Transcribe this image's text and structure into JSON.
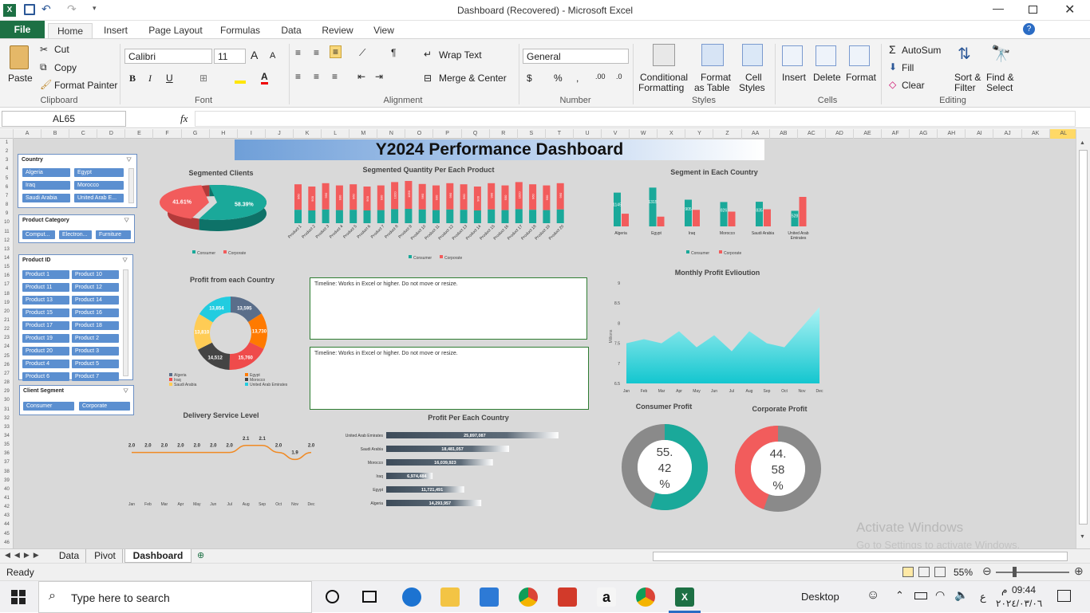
{
  "window": {
    "title": "Dashboard (Recovered)  -  Microsoft Excel"
  },
  "tabs": [
    "File",
    "Home",
    "Insert",
    "Page Layout",
    "Formulas",
    "Data",
    "Review",
    "View"
  ],
  "ribbon": {
    "clipboard": {
      "paste": "Paste",
      "cut": "Cut",
      "copy": "Copy",
      "format_painter": "Format Painter",
      "group": "Clipboard"
    },
    "font": {
      "name": "Calibri",
      "size": "11",
      "group": "Font"
    },
    "alignment": {
      "wrap": "Wrap Text",
      "merge": "Merge & Center",
      "group": "Alignment"
    },
    "number": {
      "format": "General",
      "group": "Number"
    },
    "styles": {
      "cond": "Conditional",
      "cond2": "Formatting",
      "fmt_table": "Format",
      "fmt_table2": "as Table",
      "cell": "Cell",
      "cell2": "Styles",
      "group": "Styles"
    },
    "cells": {
      "insert": "Insert",
      "delete": "Delete",
      "format": "Format",
      "group": "Cells"
    },
    "editing": {
      "autosum": "AutoSum",
      "fill": "Fill",
      "clear": "Clear",
      "sort": "Sort &",
      "sort2": "Filter",
      "find": "Find &",
      "find2": "Select",
      "group": "Editing"
    }
  },
  "formula_bar": {
    "name_box": "AL65",
    "fx": "fx",
    "formula": ""
  },
  "columns": [
    "A",
    "B",
    "C",
    "D",
    "E",
    "F",
    "G",
    "H",
    "I",
    "J",
    "K",
    "L",
    "M",
    "N",
    "O",
    "P",
    "Q",
    "R",
    "S",
    "T",
    "U",
    "V",
    "W",
    "X",
    "Y",
    "Z",
    "AA",
    "AB",
    "AC",
    "AD",
    "AE",
    "AF",
    "AG",
    "AH",
    "AI",
    "AJ",
    "AK",
    "AL"
  ],
  "rows": [
    "1",
    "2",
    "3",
    "4",
    "5",
    "6",
    "7",
    "8",
    "9",
    "10",
    "11",
    "12",
    "13",
    "14",
    "15",
    "16",
    "17",
    "18",
    "19",
    "20",
    "21",
    "22",
    "23",
    "24",
    "25",
    "26",
    "27",
    "28",
    "29",
    "30",
    "31",
    "32",
    "33",
    "34",
    "35",
    "36",
    "37",
    "38",
    "39",
    "40",
    "41",
    "42",
    "43",
    "44",
    "45",
    "46"
  ],
  "dashboard": {
    "title": "Y2024 Performance Dashboard",
    "slicers": {
      "country": {
        "title": "Country",
        "items": [
          "Algeria",
          "Egypt",
          "Iraq",
          "Morocco",
          "Saudi Arabia",
          "United Arab E..."
        ]
      },
      "category": {
        "title": "Product Category",
        "items": [
          "Comput...",
          "Electron...",
          "Furniture"
        ]
      },
      "product": {
        "title": "Product ID",
        "items": [
          "Product 1",
          "Product 10",
          "Product 11",
          "Product 12",
          "Product 13",
          "Product 14",
          "Product 15",
          "Product 16",
          "Product 17",
          "Product 18",
          "Product 19",
          "Product 2",
          "Product 20",
          "Product 3",
          "Product 4",
          "Product 5",
          "Product 6",
          "Product 7"
        ]
      },
      "segment": {
        "title": "Client Segment",
        "items": [
          "Consumer",
          "Corporate"
        ]
      }
    },
    "timeline_text": "Timeline: Works in Excel or higher. Do not move or resize.",
    "titles": {
      "segmented_clients": "Segmented Clients",
      "segmented_quantity": "Segmented Quantity  Per Each Product",
      "segment_country": "Segment in Each Country",
      "profit_country": "Profit from each Country",
      "monthly_profit": "Monthly  Profit Evlioution",
      "delivery": "Delivery Service Level",
      "profit_per_country": "Profit Per Each Country",
      "consumer_profit": "Consumer  Profit",
      "corporate_profit": "Corporate  Profit"
    },
    "legend": {
      "consumer": "Consumer",
      "corporate": "Corporate"
    },
    "colors": {
      "consumer": "#1aa99a",
      "corporate": "#f25c5c",
      "accent": "#1f70c1"
    }
  },
  "chart_data": [
    {
      "type": "pie",
      "id": "segmented_clients",
      "title": "Segmented Clients",
      "labels": [
        "Consumer",
        "Corporate"
      ],
      "values": [
        58.39,
        41.61
      ],
      "data_labels": [
        "58.39%",
        "41.61%"
      ]
    },
    {
      "type": "bar",
      "id": "segmented_quantity",
      "title": "Segmented Quantity  Per Each Product",
      "categories": [
        "Product 1",
        "Product 2",
        "Product 3",
        "Product 4",
        "Product 5",
        "Product 6",
        "Product 7",
        "Product 8",
        "Product 9",
        "Product 10",
        "Product 11",
        "Product 12",
        "Product 13",
        "Product 14",
        "Product 15",
        "Product 16",
        "Product 17",
        "Product 18",
        "Product 19",
        "Product 20"
      ],
      "series": [
        {
          "name": "Consumer",
          "values": [
            4.2,
            4.0,
            4.3,
            4.1,
            4.2,
            4.0,
            4.1,
            4.4,
            4.5,
            4.3,
            4.1,
            4.3,
            4.2,
            4.0,
            4.3,
            4.1,
            4.4,
            4.2,
            4.1,
            4.3
          ]
        },
        {
          "name": "Corporate",
          "values": [
            3.2,
            3.0,
            3.3,
            3.1,
            3.2,
            3.0,
            3.1,
            3.4,
            3.5,
            3.2,
            3.1,
            3.3,
            3.2,
            3.0,
            3.3,
            3.1,
            3.4,
            3.2,
            3.1,
            3.3
          ]
        }
      ]
    },
    {
      "type": "bar",
      "id": "segment_country",
      "title": "Segment in Each Country",
      "categories": [
        "Algeria",
        "Egypt",
        "Iraq",
        "Morocco",
        "Saudi Arabia",
        "United Arab Emirates"
      ],
      "series": [
        {
          "name": "Consumer",
          "values": [
            1145,
            1315,
            905,
            826,
            835,
            528
          ]
        },
        {
          "name": "Corporate",
          "values": [
            430,
            330,
            560,
            500,
            580,
            1000
          ]
        }
      ],
      "data_labels": [
        "1145",
        "1315",
        "905",
        "826",
        "835",
        "528"
      ]
    },
    {
      "type": "pie",
      "id": "profit_country",
      "title": "Profit from each Country",
      "labels": [
        "Algeria",
        "Egypt",
        "Iraq",
        "Morocco",
        "Saudi Arabia",
        "United Arab Emirates"
      ],
      "values": [
        13595,
        13730,
        15760,
        14512,
        13810,
        13854
      ],
      "data_labels": [
        "13,595",
        "13,730",
        "15,760",
        "14,512",
        "13,810",
        "13,854"
      ],
      "colors": [
        "#5a6e8a",
        "#ff7a00",
        "#ef4b4b",
        "#444444",
        "#ffcc55",
        "#22cce0"
      ]
    },
    {
      "type": "area",
      "id": "monthly_profit",
      "title": "Monthly  Profit Evlioution",
      "categories": [
        "Jan",
        "Feb",
        "Mar",
        "Apr",
        "May",
        "Jun",
        "Jul",
        "Aug",
        "Sep",
        "Oct",
        "Nov",
        "Dec"
      ],
      "values": [
        7.5,
        7.6,
        7.5,
        7.8,
        7.4,
        7.7,
        7.3,
        7.8,
        7.5,
        7.4,
        7.9,
        8.4
      ],
      "ylabel": "Millions",
      "yticks": [
        "9",
        "8.5",
        "8",
        "7.5",
        "7",
        "6.5"
      ],
      "ylim": [
        6.5,
        9
      ]
    },
    {
      "type": "line",
      "id": "delivery",
      "title": "Delivery Service Level",
      "categories": [
        "Jan",
        "Feb",
        "Mar",
        "Apr",
        "May",
        "Jun",
        "Jul",
        "Aug",
        "Sep",
        "Oct",
        "Nov",
        "Dec"
      ],
      "values": [
        2.0,
        2.0,
        2.0,
        2.0,
        2.0,
        2.0,
        2.0,
        2.1,
        2.1,
        2.0,
        1.9,
        2.0
      ],
      "data_labels": [
        "2.0",
        "2.0",
        "2.0",
        "2.0",
        "2.0",
        "2.0",
        "2.0",
        "2.1",
        "2.1",
        "2.0",
        "1.9",
        "2.0"
      ]
    },
    {
      "type": "bar",
      "id": "profit_per_country",
      "title": "Profit Per Each Country",
      "orientation": "horizontal",
      "categories": [
        "United Arab Emirates",
        "Saudi Arabia",
        "Morocco",
        "Iraq",
        "Egypt",
        "Algeria"
      ],
      "values": [
        25897087,
        18481057,
        16039923,
        6974484,
        11721491,
        14293957
      ],
      "data_labels": [
        "25,897,087",
        "18,481,057",
        "16,039,923",
        "6,974,484",
        "11,721,491",
        "14,293,957"
      ]
    },
    {
      "type": "pie",
      "id": "consumer_profit",
      "title": "Consumer  Profit",
      "values": [
        55.42,
        44.58
      ],
      "center_label": "55.42%"
    },
    {
      "type": "pie",
      "id": "corporate_profit",
      "title": "Corporate  Profit",
      "values": [
        44.58,
        55.42
      ],
      "center_label": "44.58%"
    }
  ],
  "sheet_tabs": [
    "Data",
    "Pivot",
    "Dashboard"
  ],
  "status": {
    "ready": "Ready",
    "zoom": "55%"
  },
  "watermark": {
    "line1": "Activate Windows",
    "line2": "Go to Settings to activate Windows."
  },
  "taskbar": {
    "search": "Type here to search",
    "desktop": "Desktop",
    "time": "09:44",
    "ampm": "م",
    "date": "٢٠٢٤/٠٣/٠٦",
    "lang": "ع"
  }
}
